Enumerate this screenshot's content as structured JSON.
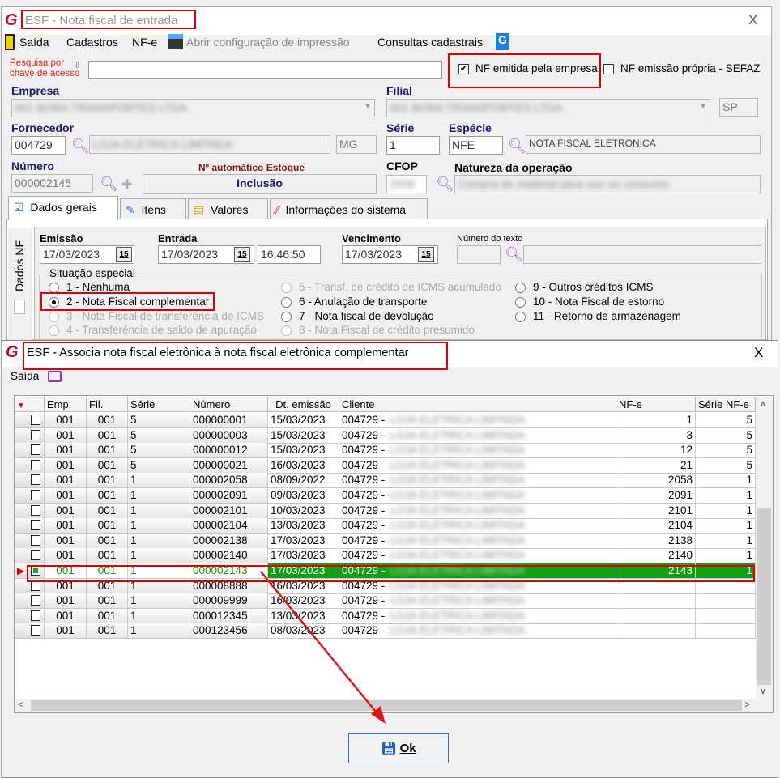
{
  "main_window": {
    "title": "ESF - Nota fiscal de entrada",
    "close": "X",
    "menu": {
      "exit": "Saída",
      "registries": "Cadastros",
      "nfe": "NF-e",
      "print_config": "Abrir configuração de impressão",
      "queries": "Consultas cadastrais"
    },
    "search": {
      "label_line1": "Pesquisa por",
      "label_line2": "chave de acesso",
      "value": ""
    },
    "nf_emitida": {
      "label": "NF emitida pela empresa",
      "checked": true
    },
    "nf_propria": {
      "label": "NF emissão própria - SEFAZ",
      "checked": false
    },
    "empresa": {
      "label": "Empresa",
      "value": "001 BORA TRANSPORTES LTDA"
    },
    "filial": {
      "label": "Filial",
      "value": "001 BORA TRANSPORTES LTDA",
      "uf": "SP"
    },
    "fornecedor": {
      "label": "Fornecedor",
      "code": "004729",
      "name": "LOJA ELETRICA LIMITADA",
      "uf": "MG"
    },
    "serie": {
      "label": "Série",
      "value": "1"
    },
    "especie": {
      "label": "Espécie",
      "code": "NFE",
      "desc": "NOTA FISCAL ELETRONICA"
    },
    "numero": {
      "label": "Número",
      "value": "000002145"
    },
    "auto_estoque": {
      "label": "Nº automático Estoque",
      "value": "Inclusão"
    },
    "cfop": {
      "label": "CFOP",
      "value": "2556"
    },
    "natureza": {
      "label": "Natureza da operação",
      "value": "Compra de material para uso ou consumo"
    },
    "tabs": [
      "Dados gerais",
      "Itens",
      "Valores",
      "Informações do sistema"
    ],
    "side_tab": "Dados NF",
    "emissao": {
      "label": "Emissão",
      "value": "17/03/2023"
    },
    "entrada": {
      "label": "Entrada",
      "value": "17/03/2023",
      "time": "16:46:50"
    },
    "vencimento": {
      "label": "Vencimento",
      "value": "17/03/2023"
    },
    "calendar_label": "15",
    "numero_texto": {
      "label": "Número do texto",
      "code": "",
      "desc": ""
    },
    "situacao": {
      "legend": "Situação especial",
      "options": [
        "1 - Nenhuma",
        "2 - Nota Fiscal complementar",
        "3 - Nota Fiscal de transferência de ICMS",
        "4 - Transferência de saldo de apuração",
        "5 - Transf. de crédito de ICMS acumulado",
        "6 - Anulação de transporte",
        "7 - Nota fiscal de devolução",
        "8 - Nota Fiscal de crédito presumido",
        "9 - Outros créditos ICMS",
        "10 - Nota Fiscal de estorno",
        "11 - Retorno de armazenagem"
      ],
      "selected": "2 - Nota Fiscal complementar"
    }
  },
  "dialog": {
    "title": "ESF - Associa nota fiscal eletrônica à nota fiscal eletrônica complementar",
    "close": "X",
    "exit": "Saída",
    "columns": [
      "Emp.",
      "Fil.",
      "Série",
      "Número",
      "Dt. emissão",
      "Cliente",
      "NF-e",
      "Série NF-e"
    ],
    "client_name": "LOJA ELETRICA LIMITADA",
    "rows": [
      [
        "001",
        "001",
        "5",
        "000000001",
        "15/03/2023",
        "004729 -",
        "1",
        "5"
      ],
      [
        "001",
        "001",
        "5",
        "000000003",
        "15/03/2023",
        "004729 -",
        "3",
        "5"
      ],
      [
        "001",
        "001",
        "5",
        "000000012",
        "15/03/2023",
        "004729 -",
        "12",
        "5"
      ],
      [
        "001",
        "001",
        "5",
        "000000021",
        "16/03/2023",
        "004729 -",
        "21",
        "5"
      ],
      [
        "001",
        "001",
        "1",
        "000002058",
        "08/09/2022",
        "004729 -",
        "2058",
        "1"
      ],
      [
        "001",
        "001",
        "1",
        "000002091",
        "09/03/2023",
        "004729 -",
        "2091",
        "1"
      ],
      [
        "001",
        "001",
        "1",
        "000002101",
        "10/03/2023",
        "004729 -",
        "2101",
        "1"
      ],
      [
        "001",
        "001",
        "1",
        "000002104",
        "13/03/2023",
        "004729 -",
        "2104",
        "1"
      ],
      [
        "001",
        "001",
        "1",
        "000002138",
        "17/03/2023",
        "004729 -",
        "2138",
        "1"
      ],
      [
        "001",
        "001",
        "1",
        "000002140",
        "17/03/2023",
        "004729 -",
        "2140",
        "1"
      ],
      [
        "001",
        "001",
        "1",
        "000002143",
        "17/03/2023",
        "004729 -",
        "2143",
        "1"
      ],
      [
        "001",
        "001",
        "1",
        "000008888",
        "16/03/2023",
        "004729 -",
        "",
        ""
      ],
      [
        "001",
        "001",
        "1",
        "000009999",
        "16/03/2023",
        "004729 -",
        "",
        ""
      ],
      [
        "001",
        "001",
        "1",
        "000012345",
        "13/03/2023",
        "004729 -",
        "",
        ""
      ],
      [
        "001",
        "001",
        "1",
        "000123456",
        "08/03/2023",
        "004729 -",
        "",
        ""
      ]
    ],
    "selected_row": 10,
    "ok": "Ok"
  },
  "colors": {
    "highlight": "#e00000",
    "selected_row": "#10a010",
    "label": "#1a1a70"
  }
}
